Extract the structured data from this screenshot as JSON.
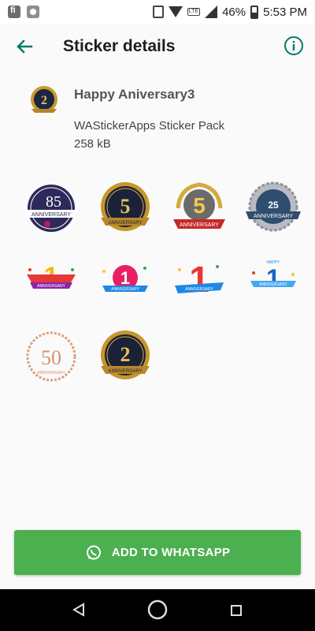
{
  "status_bar": {
    "battery": "46%",
    "time": "5:53 PM",
    "network": "LTE"
  },
  "toolbar": {
    "title": "Sticker details",
    "accent": "#00796b"
  },
  "pack": {
    "name": "Happy Aniversary3",
    "publisher": "WAStickerApps Sticker Pack",
    "size": "258 kB"
  },
  "stickers": [
    {
      "icon": "anniversary-85-sticker",
      "text": "85"
    },
    {
      "icon": "anniversary-5th-gold-sticker",
      "text": "5"
    },
    {
      "icon": "anniversary-5-years-laurel-sticker",
      "text": "5"
    },
    {
      "icon": "anniversary-25th-silver-sticker",
      "text": "25"
    },
    {
      "icon": "happy-anniversary-1-ribbon-sticker",
      "text": "1"
    },
    {
      "icon": "anniversary-1-balloon-sticker",
      "text": "1"
    },
    {
      "icon": "anniversary-1-red-sticker",
      "text": "1"
    },
    {
      "icon": "happy-anniversary-1-blue-sticker",
      "text": "1"
    },
    {
      "icon": "anniversary-50-laurel-sticker",
      "text": "50"
    },
    {
      "icon": "anniversary-2nd-gold-sticker",
      "text": "2"
    }
  ],
  "add_button": {
    "label": "ADD TO WHATSAPP",
    "color": "#4caf50"
  }
}
